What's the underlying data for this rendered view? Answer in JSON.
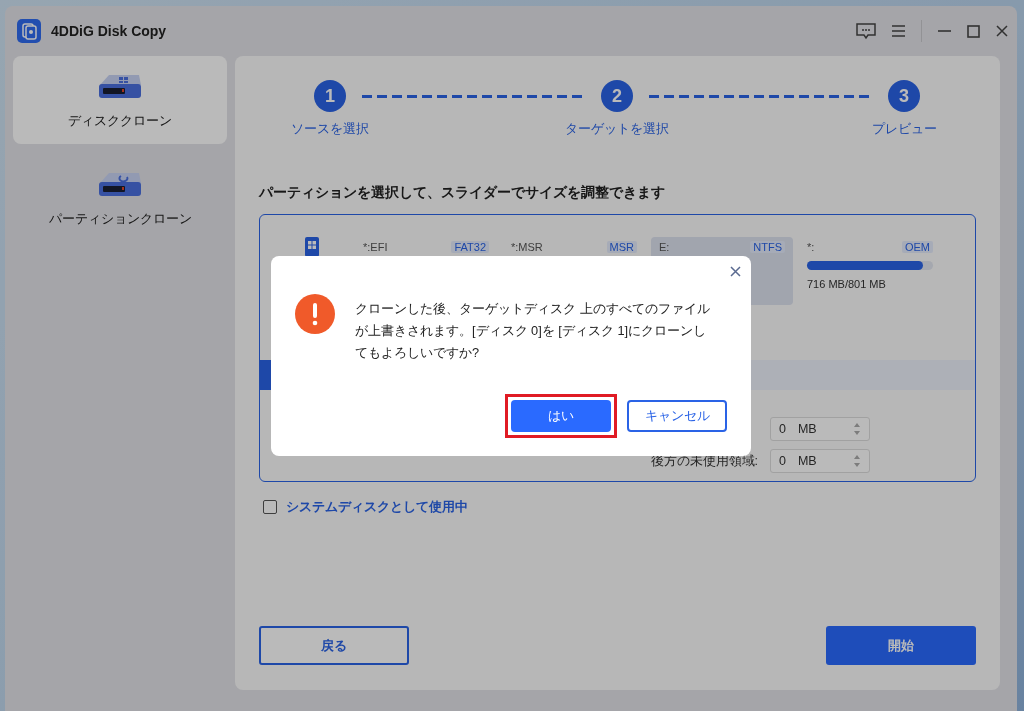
{
  "window": {
    "title": "4DDiG Disk Copy"
  },
  "sidebar": {
    "items": [
      {
        "label": "ディスククローン",
        "selected": true
      },
      {
        "label": "パーティションクローン",
        "selected": false
      }
    ]
  },
  "steps": [
    {
      "number": "1",
      "label": "ソースを選択"
    },
    {
      "number": "2",
      "label": "ターゲットを選択"
    },
    {
      "number": "3",
      "label": "プレビュー"
    }
  ],
  "heading": "パーティションを選択して、スライダーでサイズを調整できます",
  "partitions": [
    {
      "name": "*:EFI",
      "fs": "FAT32",
      "selected": false
    },
    {
      "name": "*:MSR",
      "fs": "MSR",
      "selected": false
    },
    {
      "name": "E:",
      "fs": "NTFS",
      "selected": true
    },
    {
      "name": "*:",
      "fs": "OEM",
      "selected": false,
      "level": 0.92,
      "usage": "716 MB/801 MB"
    }
  ],
  "unused_fields": [
    {
      "value": "0",
      "unit": "MB"
    },
    {
      "label": "後方の未使用領域:",
      "value": "0",
      "unit": "MB"
    }
  ],
  "system_disk": {
    "label": "システムディスクとして使用中",
    "checked": false
  },
  "buttons": {
    "back": "戻る",
    "start": "開始"
  },
  "dialog": {
    "message": "クローンした後、ターゲットディスク 上のすべてのファイルが上書きされます。[ディスク 0]を [ディスク 1]にクローンしてもよろしいですか?",
    "confirm": "はい",
    "cancel": "キャンセル",
    "confirm_highlighted": true
  }
}
